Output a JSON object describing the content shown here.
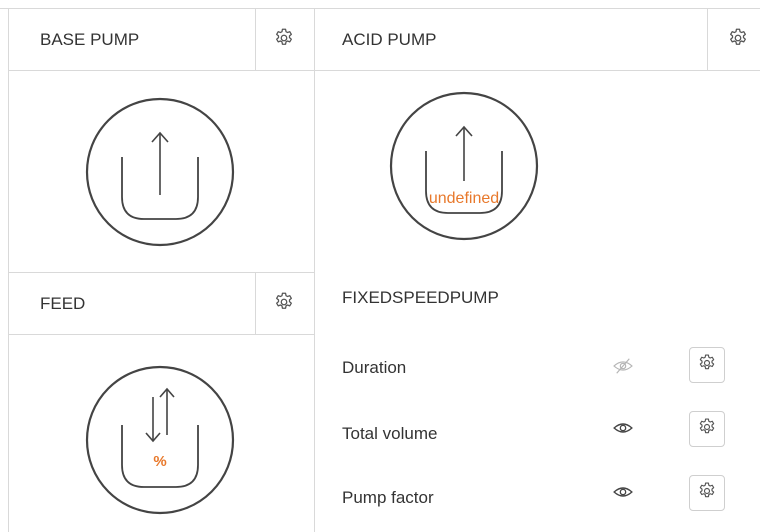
{
  "base_pump": {
    "title": "BASE PUMP",
    "settings_icon": "gear-icon",
    "pump_icon": "pump-up-arrow-icon"
  },
  "acid_pump": {
    "title": "ACID PUMP",
    "settings_icon": "gear-icon",
    "pump_icon": "pump-up-arrow-icon",
    "value": "undefined",
    "pump_type": "FIXEDSPEEDPUMP",
    "rows": [
      {
        "label": "Duration",
        "visible": false,
        "visibility_icon": "eye-slash-icon",
        "settings_icon": "gear-icon"
      },
      {
        "label": "Total volume",
        "visible": true,
        "visibility_icon": "eye-icon",
        "settings_icon": "gear-icon"
      },
      {
        "label": "Pump factor",
        "visible": true,
        "visibility_icon": "eye-icon",
        "settings_icon": "gear-icon"
      }
    ]
  },
  "feed": {
    "title": "FEED",
    "settings_icon": "gear-icon",
    "pump_icon": "pump-up-down-arrows-icon",
    "value": "%"
  },
  "colors": {
    "accent": "#e8792c",
    "border": "#d9d9d9",
    "icon": "#555555",
    "icon_disabled": "#b5b5b5"
  }
}
